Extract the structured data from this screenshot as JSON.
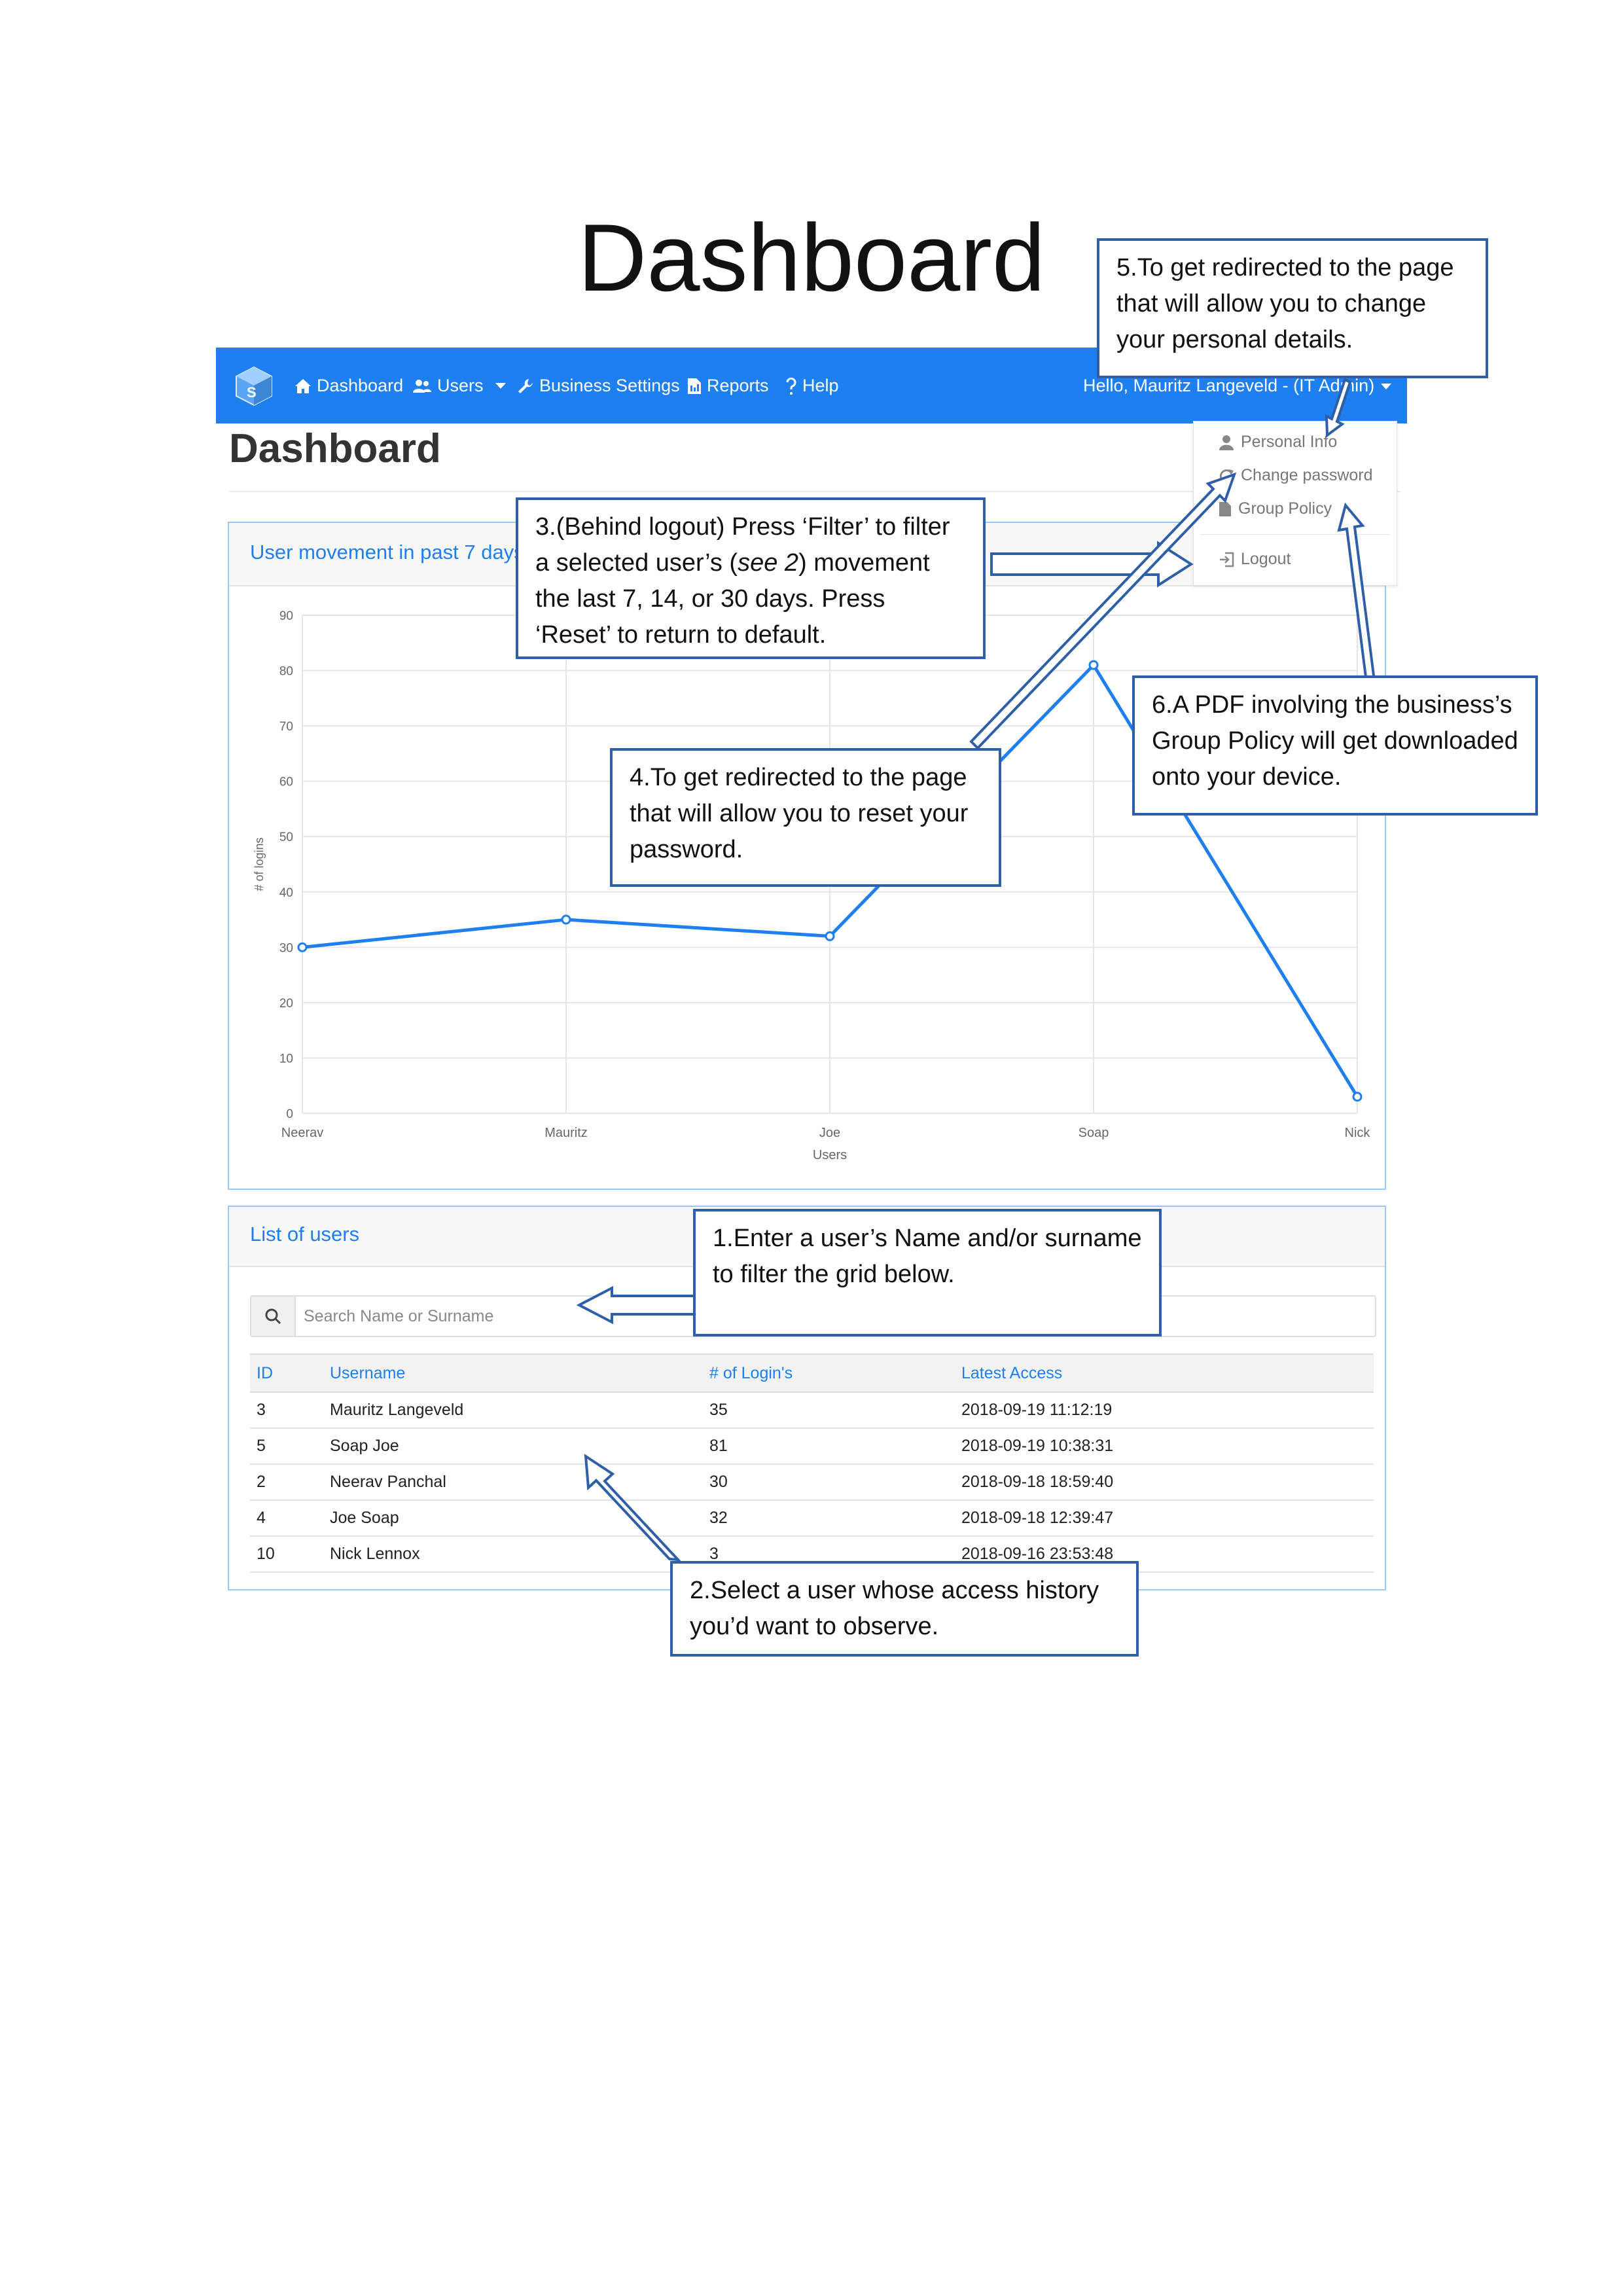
{
  "document": {
    "title": "Dashboard"
  },
  "navbar": {
    "items": [
      {
        "label": "Dashboard",
        "icon": "home-icon"
      },
      {
        "label": "Users",
        "icon": "users-icon"
      },
      {
        "label": "Business Settings",
        "icon": "wrench-icon"
      },
      {
        "label": "Reports",
        "icon": "report-icon"
      },
      {
        "label": "Help",
        "icon": "question-icon"
      }
    ],
    "user_greeting": "Hello, Mauritz Langeveld - (IT Admin)"
  },
  "page": {
    "heading": "Dashboard"
  },
  "user_menu": {
    "items": [
      {
        "label": "Personal Info",
        "icon": "user-icon"
      },
      {
        "label": "Change password",
        "icon": "refresh-icon"
      },
      {
        "label": "Group Policy",
        "icon": "file-icon"
      },
      {
        "label": "Logout",
        "icon": "logout-icon"
      }
    ]
  },
  "movement_card": {
    "title": "User movement in past 7 days"
  },
  "chart_data": {
    "type": "line",
    "categories": [
      "Neerav",
      "Mauritz",
      "Joe",
      "Soap",
      "Nick"
    ],
    "series": [
      {
        "values": [
          30,
          35,
          32,
          81,
          3
        ]
      }
    ],
    "xlabel": "Users",
    "ylabel": "# of logins",
    "ylim": [
      0,
      90
    ],
    "yticks": [
      "0",
      "10",
      "20",
      "30",
      "40",
      "50",
      "60",
      "70",
      "80",
      "90"
    ],
    "grid": true,
    "color": "#1e7ff0"
  },
  "users_card": {
    "title": "List of users",
    "search_placeholder": "Search Name or Surname",
    "columns": [
      "ID",
      "Username",
      "# of Login's",
      "Latest Access"
    ],
    "rows": [
      [
        "3",
        "Mauritz Langeveld",
        "35",
        "2018-09-19 11:12:19"
      ],
      [
        "5",
        "Soap Joe",
        "81",
        "2018-09-19 10:38:31"
      ],
      [
        "2",
        "Neerav Panchal",
        "30",
        "2018-09-18 18:59:40"
      ],
      [
        "4",
        "Joe Soap",
        "32",
        "2018-09-18 12:39:47"
      ],
      [
        "10",
        "Nick Lennox",
        "3",
        "2018-09-16 23:53:48"
      ]
    ]
  },
  "callouts": {
    "c1": "1.Enter a user’s Name and/or surname to filter the grid below.",
    "c2": "2.Select a user whose access history you’d want to observe.",
    "c3_a": "3.(Behind logout) Press ‘Filter’ to filter a selected user’s (",
    "c3_em": "see 2",
    "c3_b": ") movement the last 7, 14, or 30 days. Press ‘Reset’ to return to default.",
    "c4": "4.To get redirected to the page that will allow you to reset your password.",
    "c5": "5.To get redirected to the page that will allow you to change your personal details.",
    "c6": "6.A PDF involving the business’s Group Policy will get downloaded onto your device."
  },
  "colors": {
    "brand": "#1e7ff0",
    "callout_border": "#2e5fa8"
  }
}
